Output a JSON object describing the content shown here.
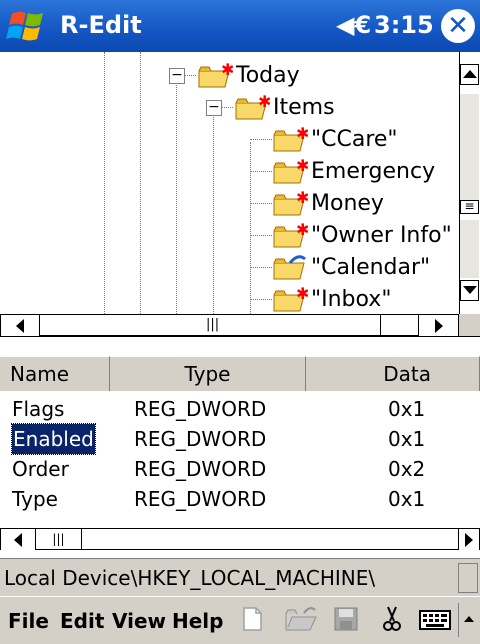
{
  "app": {
    "title": "R-Edit",
    "time": "3:15"
  },
  "tree": {
    "items": [
      {
        "label": "Today",
        "expander": "−"
      },
      {
        "label": "Items",
        "expander": "−"
      },
      {
        "label": "\"CCare\""
      },
      {
        "label": "Emergency"
      },
      {
        "label": "Money"
      },
      {
        "label": "\"Owner Info\""
      },
      {
        "label": "\"Calendar\""
      },
      {
        "label": "\"Inbox\""
      }
    ],
    "hscroll_grip": "|||"
  },
  "list": {
    "columns": [
      "Name",
      "Type",
      "Data"
    ],
    "rows": [
      {
        "name": "Flags",
        "type": "REG_DWORD",
        "data": "0x1"
      },
      {
        "name": "Enabled",
        "type": "REG_DWORD",
        "data": "0x1"
      },
      {
        "name": "Order",
        "type": "REG_DWORD",
        "data": "0x2"
      },
      {
        "name": "Type",
        "type": "REG_DWORD",
        "data": "0x1"
      }
    ],
    "selected_row": "Enabled",
    "hscroll_grip": "|||"
  },
  "path": "Local Device\\HKEY_LOCAL_MACHINE\\",
  "menubar": {
    "file": "File",
    "edit": "Edit",
    "view": "View",
    "help": "Help"
  },
  "icons": [
    "windows-logo-icon",
    "volume-icon",
    "close-icon",
    "folder-icon",
    "calendar-folder-icon",
    "new-file-icon",
    "open-folder-icon",
    "save-icon",
    "cut-icon",
    "keyboard-icon"
  ],
  "colors": {
    "titlebar": "#1356c4",
    "selection": "#0a246a",
    "chrome": "#d4d0c8"
  }
}
